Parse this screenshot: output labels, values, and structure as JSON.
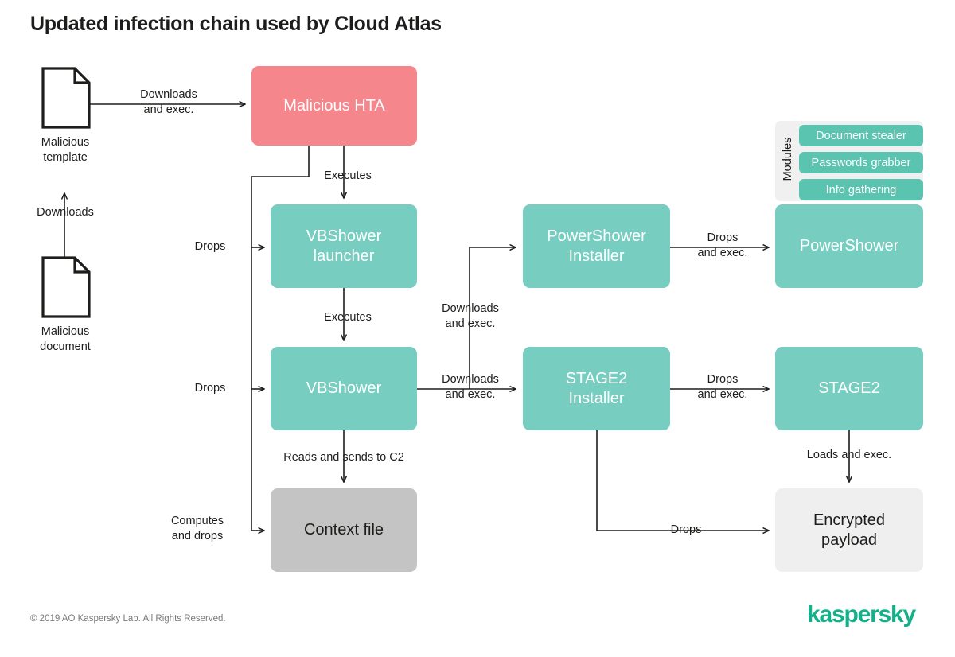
{
  "title": "Updated infection chain used by Cloud Atlas",
  "colors": {
    "pink": "#F4868C",
    "teal": "#76CDC0",
    "module_teal": "#5BC4B1",
    "grey": "#C4C4C4",
    "light_grey": "#EFEFEF",
    "panel_grey": "#F0F0F0",
    "line": "#1d1d1b",
    "brand": "#14B08A"
  },
  "sources": [
    {
      "id": "malicious-template",
      "caption": "Malicious\ntemplate",
      "icon": "document-icon"
    },
    {
      "id": "malicious-document",
      "caption": "Malicious\ndocument",
      "icon": "document-icon"
    }
  ],
  "nodes": {
    "malicious_hta": "Malicious HTA",
    "vbshower_launcher": "VBShower\nlauncher",
    "vbshower": "VBShower",
    "context_file": "Context file",
    "powershower_installer": "PowerShower\nInstaller",
    "stage2_installer": "STAGE2\nInstaller",
    "powershower": "PowerShower",
    "stage2": "STAGE2",
    "encrypted_payload": "Encrypted\npayload"
  },
  "edges": {
    "doc_downloads_template": "Downloads",
    "template_to_hta": "Downloads\nand exec.",
    "hta_executes_launcher": "Executes",
    "hta_drops_launcher": "Drops",
    "launcher_executes_vbshower": "Executes",
    "hta_drops_vbshower": "Drops",
    "vbshower_reads_context": "Reads and sends to C2",
    "hta_computes_context": "Computes\nand drops",
    "vbshower_to_powershower_installer": "Downloads\nand exec.",
    "vbshower_to_stage2_installer": "Downloads\nand exec.",
    "powershower_installer_drops": "Drops\nand exec.",
    "stage2_installer_drops": "Drops\nand exec.",
    "stage2_loads_payload": "Loads and exec.",
    "stage2_installer_drops_payload": "Drops"
  },
  "modules": {
    "label": "Modules",
    "items": [
      "Document stealer",
      "Passwords grabber",
      "Info gathering"
    ]
  },
  "footer": {
    "copyright": "© 2019 AO Kaspersky Lab. All Rights Reserved.",
    "brand": "kaspersky"
  }
}
